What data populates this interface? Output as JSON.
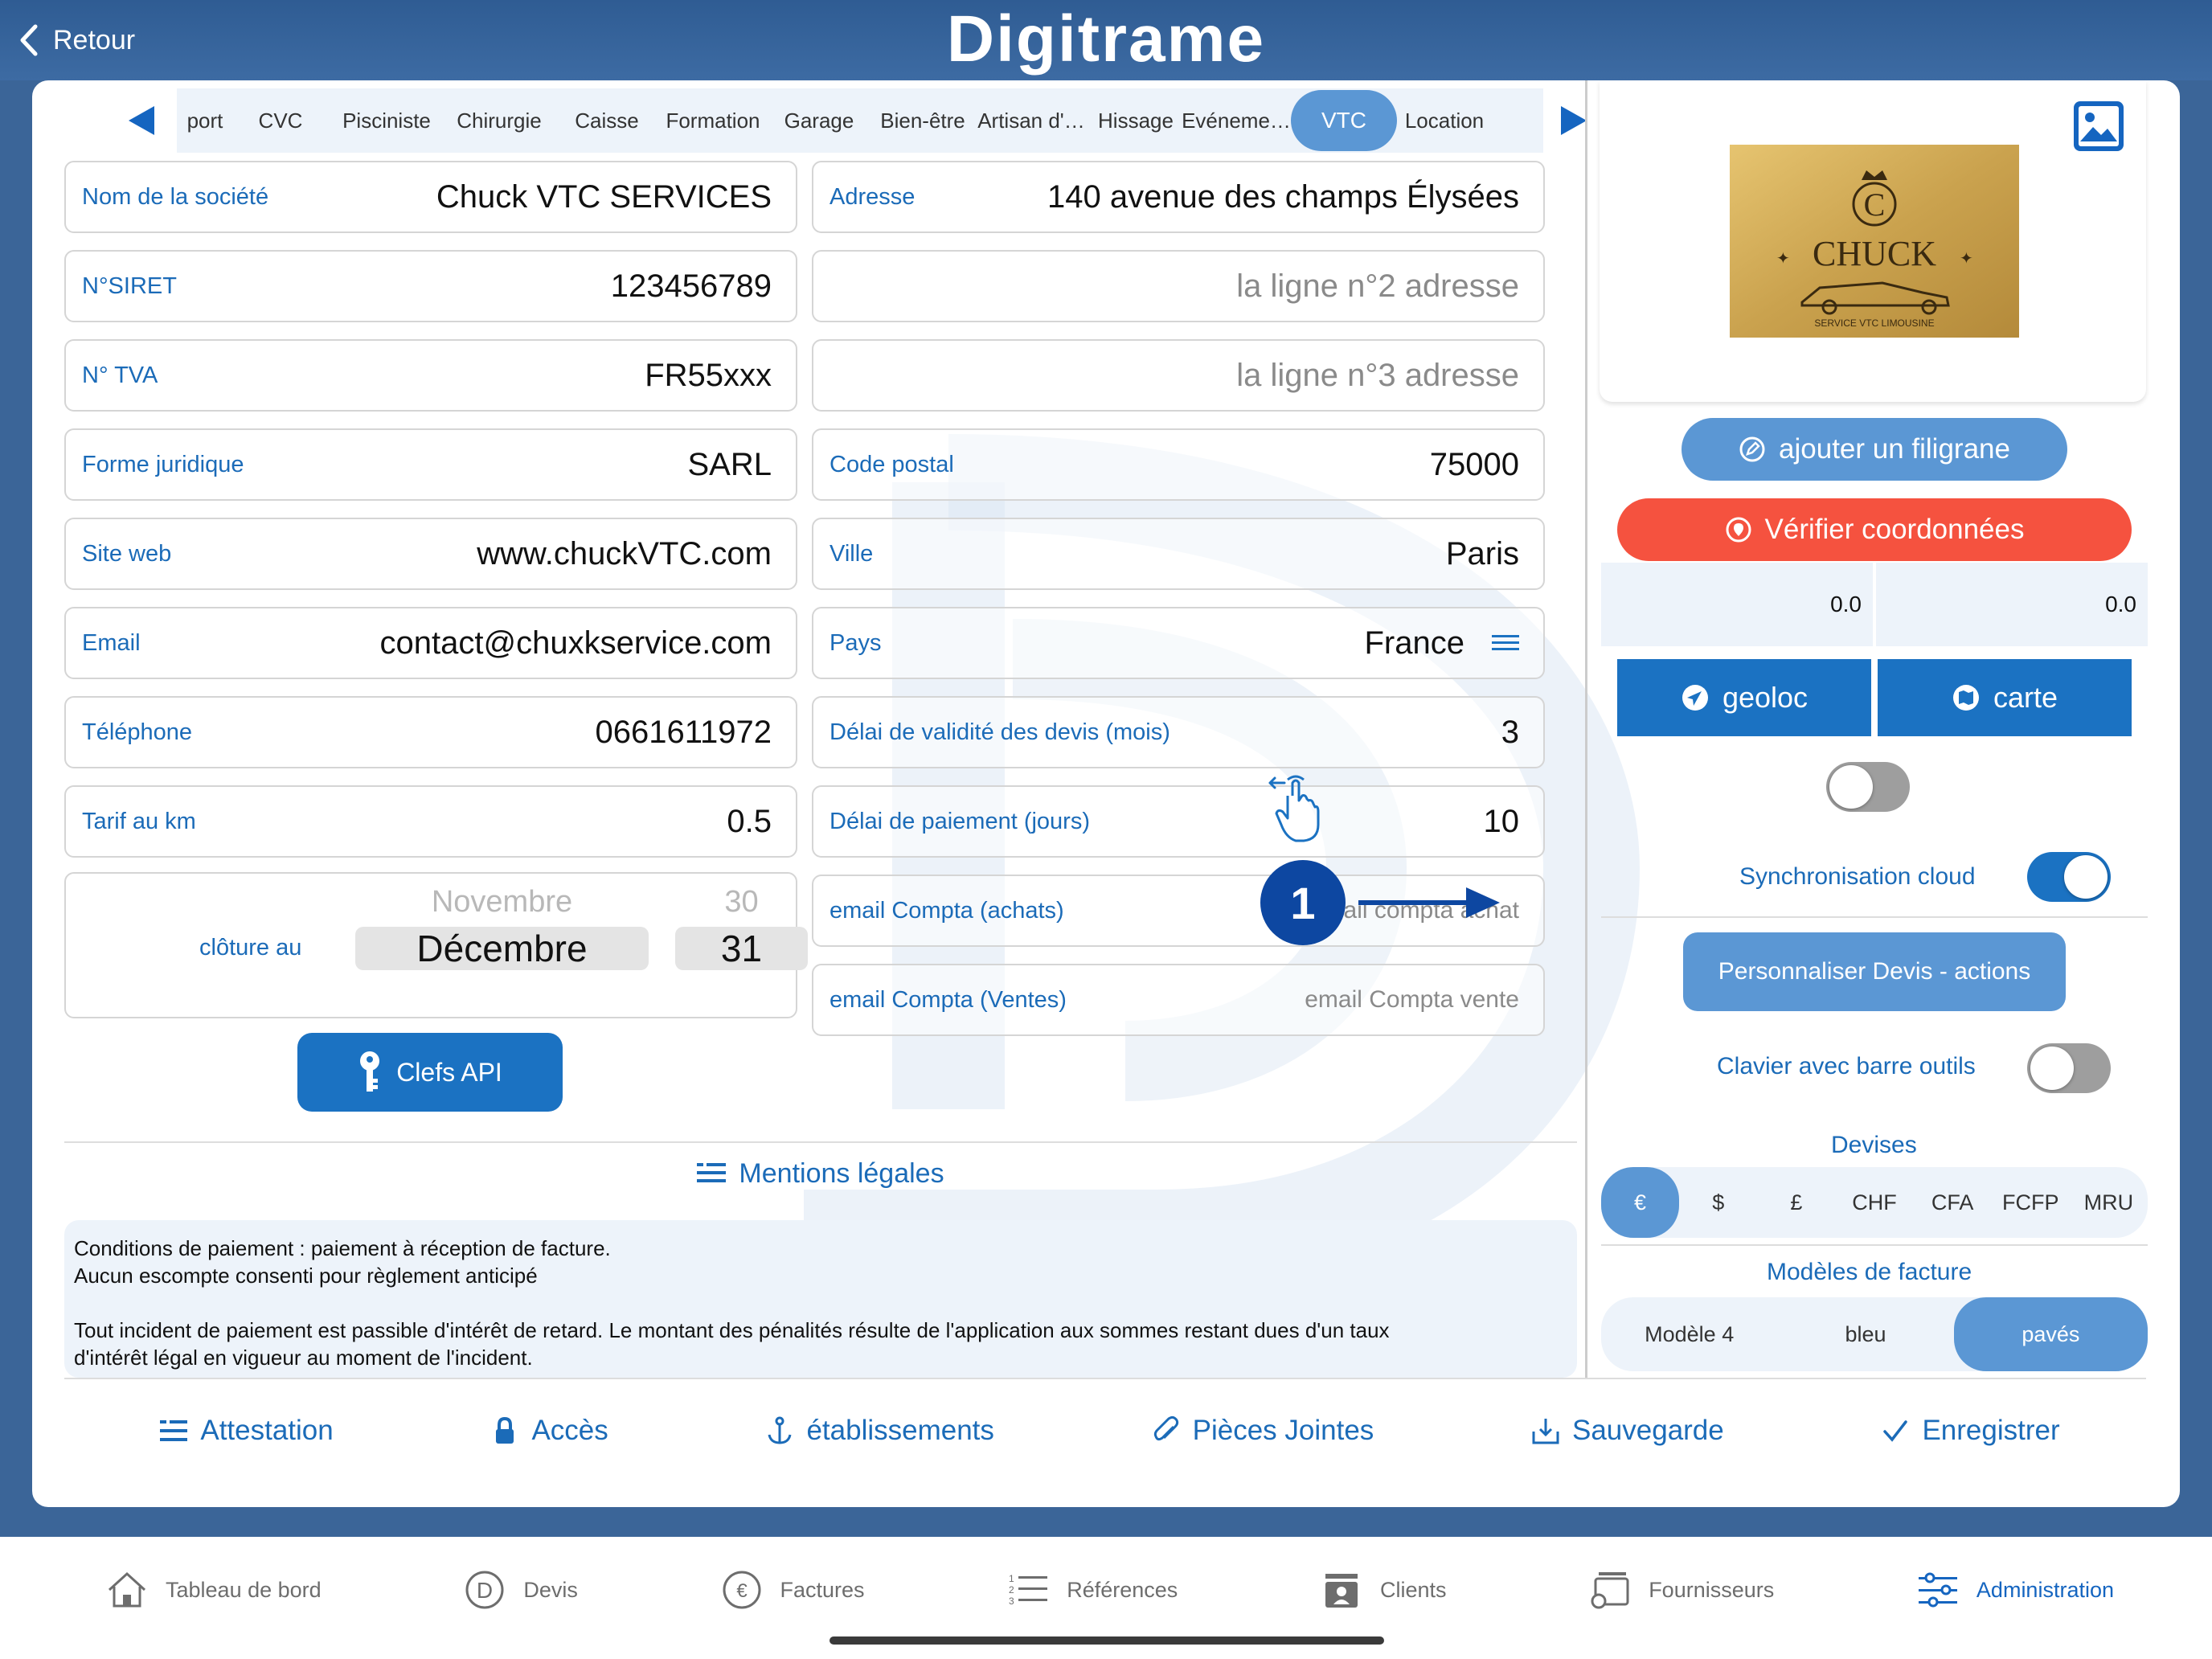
{
  "header": {
    "back_label": "Retour",
    "app_title": "Digitrame"
  },
  "tabs": [
    "port",
    "CVC",
    "Pisciniste",
    "Chirurgie",
    "Caisse",
    "Formation",
    "Garage",
    "Bien-être",
    "Artisan d'…",
    "Hissage",
    "Evéneme…",
    "VTC",
    "Location"
  ],
  "selected_tab": "VTC",
  "left_fields": [
    {
      "label": "Nom de la société",
      "value": "Chuck VTC SERVICES"
    },
    {
      "label": "N°SIRET",
      "value": "123456789"
    },
    {
      "label": "N° TVA",
      "value": "FR55xxx"
    },
    {
      "label": "Forme juridique",
      "value": "SARL"
    },
    {
      "label": "Site web",
      "value": "www.chuckVTC.com"
    },
    {
      "label": "Email",
      "value": "contact@chuxkservice.com"
    },
    {
      "label": "Téléphone",
      "value": "0661611972"
    },
    {
      "label": "Tarif au km",
      "value": "0.5"
    }
  ],
  "right_fields": {
    "adresse": {
      "label": "Adresse",
      "value": "140 avenue des champs Élysées"
    },
    "adresse2": {
      "placeholder": "la ligne n°2 adresse"
    },
    "adresse3": {
      "placeholder": "la ligne n°3 adresse"
    },
    "code_postal": {
      "label": "Code postal",
      "value": "75000"
    },
    "ville": {
      "label": "Ville",
      "value": "Paris"
    },
    "pays": {
      "label": "Pays",
      "value": "France"
    },
    "delai_devis": {
      "label": "Délai de validité des devis (mois)",
      "value": "3"
    },
    "delai_paiement": {
      "label": "Délai de paiement (jours)",
      "value": "10"
    },
    "email_achats": {
      "label": "email Compta (achats)",
      "placeholder": "email compta achat"
    },
    "email_ventes": {
      "label": "email Compta (Ventes)",
      "placeholder": "email Compta vente"
    }
  },
  "closure": {
    "label": "clôture au",
    "month_prev": "Novembre",
    "month": "Décembre",
    "day_prev": "30",
    "day": "31"
  },
  "api_button": "Clefs API",
  "mentions": {
    "title": "Mentions légales",
    "lines": [
      "Conditions de paiement : paiement à réception de facture.",
      "Aucun escompte consenti pour règlement anticipé",
      "",
      "Tout incident de paiement est passible d'intérêt de retard. Le montant des pénalités résulte de l'application aux sommes restant dues d'un taux",
      "d'intérêt légal en vigueur au moment de l'incident."
    ]
  },
  "annotation_badge": "1",
  "logo": {
    "brand": "CHUCK",
    "tagline": "SERVICE VTC LIMOUSINE",
    "monogram": "C"
  },
  "right_panel": {
    "filigrane": "ajouter un filigrane",
    "verifier": "Vérifier coordonnées",
    "lat": "0.0",
    "lon": "0.0",
    "geoloc": "geoloc",
    "carte": "carte",
    "sync_label": "Synchronisation cloud",
    "perso_button": "Personnaliser Devis - actions",
    "clavier_label": "Clavier avec barre outils",
    "devises_title": "Devises",
    "devises": [
      "€",
      "$",
      "£",
      "CHF",
      "CFA",
      "FCFP",
      "MRU"
    ],
    "modeles_title": "Modèles de facture",
    "modeles": [
      "Modèle 4",
      "bleu",
      "pavés"
    ]
  },
  "bottom_actions": [
    "Attestation",
    "Accès",
    "établissements",
    "Pièces Jointes",
    "Sauvegarde",
    "Enregistrer"
  ],
  "tabbar": [
    "Tableau de bord",
    "Devis",
    "Factures",
    "Références",
    "Clients",
    "Fournisseurs",
    "Administration"
  ],
  "colors": {
    "primary": "#1b72c2",
    "accent": "#5b97d4",
    "danger": "#f5523f",
    "label": "#1b6bb8",
    "header_bg": "#3b6598"
  }
}
